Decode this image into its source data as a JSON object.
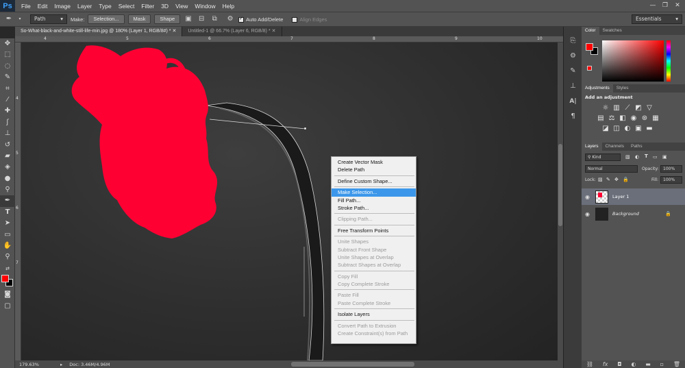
{
  "app": {
    "logo": "Ps"
  },
  "menubar": [
    "File",
    "Edit",
    "Image",
    "Layer",
    "Type",
    "Select",
    "Filter",
    "3D",
    "View",
    "Window",
    "Help"
  ],
  "window_controls": {
    "minimize": "—",
    "maximize": "❐",
    "close": "✕"
  },
  "options": {
    "mode_value": "Path",
    "make_label": "Make:",
    "selection_btn": "Selection...",
    "mask_btn": "Mask",
    "shape_btn": "Shape",
    "auto_add_delete": "Auto Add/Delete",
    "align_edges": "Align Edges",
    "workspace": "Essentials"
  },
  "tabs": [
    {
      "label": "So-What-black-and-white-still-life-min.jpg @ 180% (Layer 1, RGB/8#) *"
    },
    {
      "label": "Untitled-1 @ 66.7% (Layer 6, RGB/8) *"
    }
  ],
  "ruler": {
    "top": [
      "4",
      "5",
      "6",
      "7",
      "8",
      "9",
      "10"
    ],
    "left": [
      "4",
      "5",
      "6",
      "7"
    ]
  },
  "status": {
    "zoom": "179.63%",
    "doc": "Doc: 3.46M/4.96M"
  },
  "context_menu": [
    {
      "label": "Create Vector Mask",
      "enabled": true
    },
    {
      "label": "Delete Path",
      "enabled": true
    },
    {
      "sep": true
    },
    {
      "label": "Define Custom Shape...",
      "enabled": true
    },
    {
      "sep": true
    },
    {
      "label": "Make Selection...",
      "enabled": true,
      "highlight": true
    },
    {
      "label": "Fill Path...",
      "enabled": true
    },
    {
      "label": "Stroke Path...",
      "enabled": true
    },
    {
      "sep": true
    },
    {
      "label": "Clipping Path...",
      "enabled": false
    },
    {
      "sep": true
    },
    {
      "label": "Free Transform Points",
      "enabled": true
    },
    {
      "sep": true
    },
    {
      "label": "Unite Shapes",
      "enabled": false
    },
    {
      "label": "Subtract Front Shape",
      "enabled": false
    },
    {
      "label": "Unite Shapes at Overlap",
      "enabled": false
    },
    {
      "label": "Subtract Shapes at Overlap",
      "enabled": false
    },
    {
      "sep": true
    },
    {
      "label": "Copy Fill",
      "enabled": false
    },
    {
      "label": "Copy Complete Stroke",
      "enabled": false
    },
    {
      "sep": true
    },
    {
      "label": "Paste Fill",
      "enabled": false
    },
    {
      "label": "Paste Complete Stroke",
      "enabled": false
    },
    {
      "sep": true
    },
    {
      "label": "Isolate Layers",
      "enabled": true
    },
    {
      "sep": true
    },
    {
      "label": "Convert Path to Extrusion",
      "enabled": false
    },
    {
      "label": "Create Constraint(s) from Path",
      "enabled": false
    }
  ],
  "color_panel": {
    "tabs": [
      "Color",
      "Swatches"
    ],
    "foreground": "#ff0000",
    "background": "#000000"
  },
  "adjustments_panel": {
    "tabs": [
      "Adjustments",
      "Styles"
    ],
    "title": "Add an adjustment"
  },
  "layers_panel": {
    "tabs": [
      "Layers",
      "Channels",
      "Paths"
    ],
    "kind": "Kind",
    "blend_mode": "Normal",
    "opacity_label": "Opacity:",
    "opacity": "100%",
    "lock_label": "Lock:",
    "fill_label": "Fill:",
    "fill": "100%",
    "layers": [
      {
        "name": "Layer 1",
        "selected": true
      },
      {
        "name": "Background",
        "selected": false,
        "locked": true
      }
    ]
  },
  "colors": {
    "accent": "#3c97ea",
    "brand_red": "#ff0033",
    "ui_gray": "#535353"
  }
}
